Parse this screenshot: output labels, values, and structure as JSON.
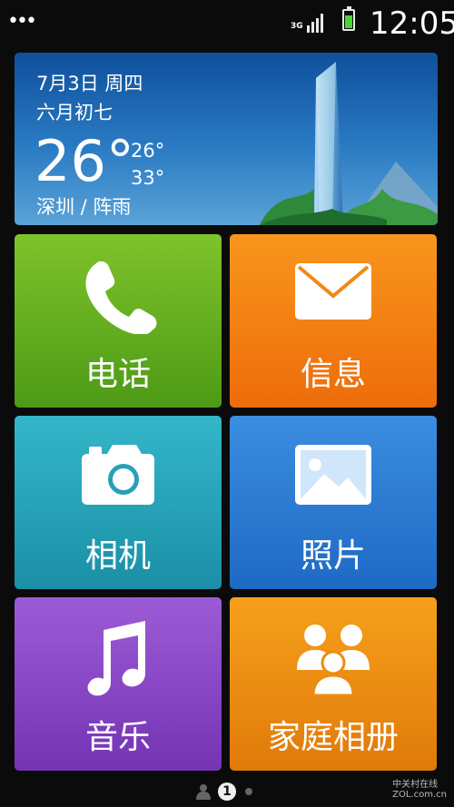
{
  "status": {
    "network": "3G",
    "time": "12:05"
  },
  "weather": {
    "date": "7月3日 周四",
    "lunar": "六月初七",
    "current_temp": "26°",
    "high": "26°",
    "low": "33°",
    "location": "深圳 / 阵雨"
  },
  "tiles": [
    {
      "label": "电话",
      "color": "#6fb424"
    },
    {
      "label": "信息",
      "color": "#f37f12"
    },
    {
      "label": "相机",
      "color": "#28a5bb"
    },
    {
      "label": "照片",
      "color": "#2c7dd4"
    },
    {
      "label": "音乐",
      "color": "#8747c4"
    },
    {
      "label": "家庭相册",
      "color": "#ec8c12"
    }
  ],
  "pager": {
    "current": "1",
    "total": 2
  },
  "watermark": {
    "text": "中关村在线",
    "sub": "ZOL.com.cn"
  }
}
